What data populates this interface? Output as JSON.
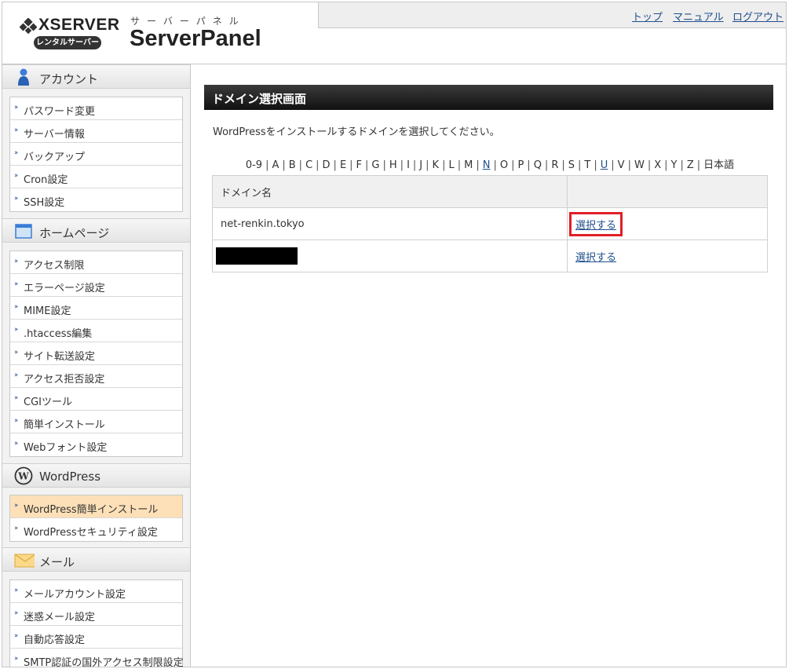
{
  "header": {
    "brand": "XSERVER",
    "badge": "レンタルサーバー",
    "panel_kana": "サーバーパネル",
    "panel_title": "ServerPanel",
    "nav": [
      "トップ",
      "マニュアル",
      "ログアウト"
    ]
  },
  "sidebar": {
    "account": {
      "title": "アカウント",
      "items": [
        "パスワード変更",
        "サーバー情報",
        "バックアップ",
        "Cron設定",
        "SSH設定"
      ]
    },
    "homepage": {
      "title": "ホームページ",
      "items": [
        "アクセス制限",
        "エラーページ設定",
        "MIME設定",
        ".htaccess編集",
        "サイト転送設定",
        "アクセス拒否設定",
        "CGIツール",
        "簡単インストール",
        "Webフォント設定"
      ]
    },
    "wordpress": {
      "title": "WordPress",
      "items": [
        "WordPress簡単インストール",
        "WordPressセキュリティ設定"
      ],
      "active_index": 0
    },
    "mail": {
      "title": "メール",
      "items": [
        "メールアカウント設定",
        "迷惑メール設定",
        "自動応答設定",
        "SMTP認証の国外アクセス制限設定"
      ]
    }
  },
  "main": {
    "title": "ドメイン選択画面",
    "instruction": "WordPressをインストールするドメインを選択してください。",
    "alphabet": [
      "0-9",
      "A",
      "B",
      "C",
      "D",
      "E",
      "F",
      "G",
      "H",
      "I",
      "J",
      "K",
      "L",
      "M",
      "N",
      "O",
      "P",
      "Q",
      "R",
      "S",
      "T",
      "U",
      "V",
      "W",
      "X",
      "Y",
      "Z",
      "日本語"
    ],
    "alphabet_links": [
      "N",
      "U"
    ],
    "table": {
      "header": [
        "ドメイン名",
        ""
      ],
      "rows": [
        {
          "domain": "net-renkin.tokyo",
          "action": "選択する",
          "highlighted": true
        },
        {
          "domain": "",
          "action": "選択する",
          "redacted": true
        }
      ]
    }
  },
  "colors": {
    "link": "#1f4e8c",
    "highlight": "#e01f26",
    "active_menu": "#fde0b8",
    "titlebar": "#1a1a1a"
  }
}
